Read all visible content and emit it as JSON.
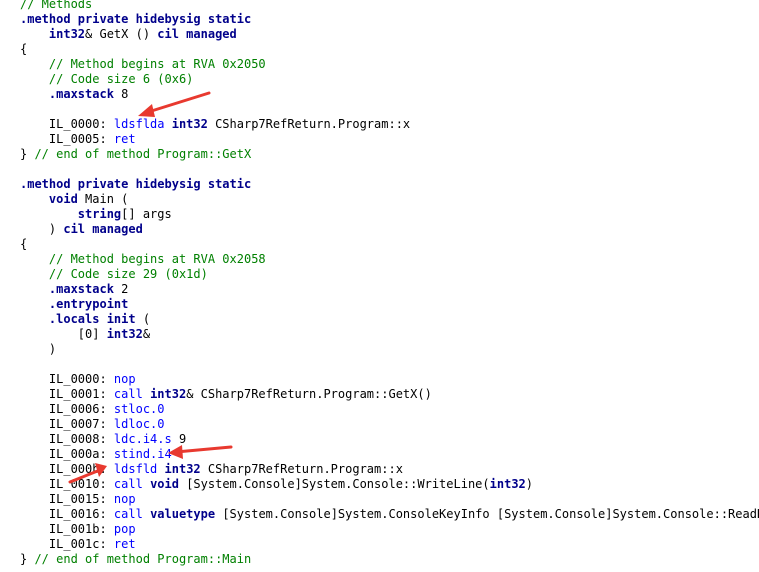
{
  "code_lines": [
    [
      {
        "c": "cm",
        "t": "// Methods"
      }
    ],
    [
      {
        "c": "kb",
        "t": ".method private hidebysig static"
      }
    ],
    [
      {
        "c": "tx",
        "t": "    "
      },
      {
        "c": "kb",
        "t": "int32"
      },
      {
        "c": "tx",
        "t": "& GetX () "
      },
      {
        "c": "kb",
        "t": "cil managed"
      }
    ],
    [
      {
        "c": "tx",
        "t": "{"
      }
    ],
    [
      {
        "c": "tx",
        "t": "    "
      },
      {
        "c": "cm",
        "t": "// Method begins at RVA 0x2050"
      }
    ],
    [
      {
        "c": "tx",
        "t": "    "
      },
      {
        "c": "cm",
        "t": "// Code size 6 (0x6)"
      }
    ],
    [
      {
        "c": "tx",
        "t": "    "
      },
      {
        "c": "kb",
        "t": ".maxstack"
      },
      {
        "c": "tx",
        "t": " 8"
      }
    ],
    [],
    [
      {
        "c": "tx",
        "t": "    IL_0000: "
      },
      {
        "c": "kw",
        "t": "ldsflda"
      },
      {
        "c": "tx",
        "t": " "
      },
      {
        "c": "kb",
        "t": "int32"
      },
      {
        "c": "tx",
        "t": " CSharp7RefReturn.Program::x"
      }
    ],
    [
      {
        "c": "tx",
        "t": "    IL_0005: "
      },
      {
        "c": "kw",
        "t": "ret"
      }
    ],
    [
      {
        "c": "tx",
        "t": "} "
      },
      {
        "c": "cm",
        "t": "// end of method Program::GetX"
      }
    ],
    [],
    [
      {
        "c": "kb",
        "t": ".method private hidebysig static"
      }
    ],
    [
      {
        "c": "tx",
        "t": "    "
      },
      {
        "c": "kb",
        "t": "void"
      },
      {
        "c": "tx",
        "t": " Main ("
      }
    ],
    [
      {
        "c": "tx",
        "t": "        "
      },
      {
        "c": "kb",
        "t": "string"
      },
      {
        "c": "tx",
        "t": "[] args"
      }
    ],
    [
      {
        "c": "tx",
        "t": "    ) "
      },
      {
        "c": "kb",
        "t": "cil managed"
      }
    ],
    [
      {
        "c": "tx",
        "t": "{"
      }
    ],
    [
      {
        "c": "tx",
        "t": "    "
      },
      {
        "c": "cm",
        "t": "// Method begins at RVA 0x2058"
      }
    ],
    [
      {
        "c": "tx",
        "t": "    "
      },
      {
        "c": "cm",
        "t": "// Code size 29 (0x1d)"
      }
    ],
    [
      {
        "c": "tx",
        "t": "    "
      },
      {
        "c": "kb",
        "t": ".maxstack"
      },
      {
        "c": "tx",
        "t": " 2"
      }
    ],
    [
      {
        "c": "tx",
        "t": "    "
      },
      {
        "c": "kb",
        "t": ".entrypoint"
      }
    ],
    [
      {
        "c": "tx",
        "t": "    "
      },
      {
        "c": "kb",
        "t": ".locals init"
      },
      {
        "c": "tx",
        "t": " ("
      }
    ],
    [
      {
        "c": "tx",
        "t": "        [0] "
      },
      {
        "c": "kb",
        "t": "int32"
      },
      {
        "c": "tx",
        "t": "&"
      }
    ],
    [
      {
        "c": "tx",
        "t": "    )"
      }
    ],
    [],
    [
      {
        "c": "tx",
        "t": "    IL_0000: "
      },
      {
        "c": "kw",
        "t": "nop"
      }
    ],
    [
      {
        "c": "tx",
        "t": "    IL_0001: "
      },
      {
        "c": "kw",
        "t": "call"
      },
      {
        "c": "tx",
        "t": " "
      },
      {
        "c": "kb",
        "t": "int32"
      },
      {
        "c": "tx",
        "t": "& CSharp7RefReturn.Program::GetX()"
      }
    ],
    [
      {
        "c": "tx",
        "t": "    IL_0006: "
      },
      {
        "c": "kw",
        "t": "stloc.0"
      }
    ],
    [
      {
        "c": "tx",
        "t": "    IL_0007: "
      },
      {
        "c": "kw",
        "t": "ldloc.0"
      }
    ],
    [
      {
        "c": "tx",
        "t": "    IL_0008: "
      },
      {
        "c": "kw",
        "t": "ldc.i4.s"
      },
      {
        "c": "tx",
        "t": " 9"
      }
    ],
    [
      {
        "c": "tx",
        "t": "    IL_000a: "
      },
      {
        "c": "kw",
        "t": "stind.i4"
      }
    ],
    [
      {
        "c": "tx",
        "t": "    IL_000b: "
      },
      {
        "c": "kw",
        "t": "ldsfld"
      },
      {
        "c": "tx",
        "t": " "
      },
      {
        "c": "kb",
        "t": "int32"
      },
      {
        "c": "tx",
        "t": " CSharp7RefReturn.Program::x"
      }
    ],
    [
      {
        "c": "tx",
        "t": "    IL_0010: "
      },
      {
        "c": "kw",
        "t": "call"
      },
      {
        "c": "tx",
        "t": " "
      },
      {
        "c": "kb",
        "t": "void"
      },
      {
        "c": "tx",
        "t": " [System.Console]System.Console::WriteLine("
      },
      {
        "c": "kb",
        "t": "int32"
      },
      {
        "c": "tx",
        "t": ")"
      }
    ],
    [
      {
        "c": "tx",
        "t": "    IL_0015: "
      },
      {
        "c": "kw",
        "t": "nop"
      }
    ],
    [
      {
        "c": "tx",
        "t": "    IL_0016: "
      },
      {
        "c": "kw",
        "t": "call"
      },
      {
        "c": "tx",
        "t": " "
      },
      {
        "c": "kb",
        "t": "valuetype"
      },
      {
        "c": "tx",
        "t": " [System.Console]System.ConsoleKeyInfo [System.Console]System.Console::ReadKey("
      }
    ],
    [
      {
        "c": "tx",
        "t": "    IL_001b: "
      },
      {
        "c": "kw",
        "t": "pop"
      }
    ],
    [
      {
        "c": "tx",
        "t": "    IL_001c: "
      },
      {
        "c": "kw",
        "t": "ret"
      }
    ],
    [
      {
        "c": "tx",
        "t": "} "
      },
      {
        "c": "cm",
        "t": "// end of method Program::Main"
      }
    ]
  ],
  "annotation_arrows": [
    {
      "name": "arrow-to-ldsflda",
      "target_line": 8
    },
    {
      "name": "arrow-to-stind-i4",
      "target_line": 30
    },
    {
      "name": "arrow-to-ldsfld",
      "target_line": 31
    }
  ],
  "colors": {
    "background": "#ffffff",
    "comment": "#008000",
    "keyword": "#0000ff",
    "directive": "#00008b",
    "text": "#000000",
    "arrow": "#e8392f"
  }
}
